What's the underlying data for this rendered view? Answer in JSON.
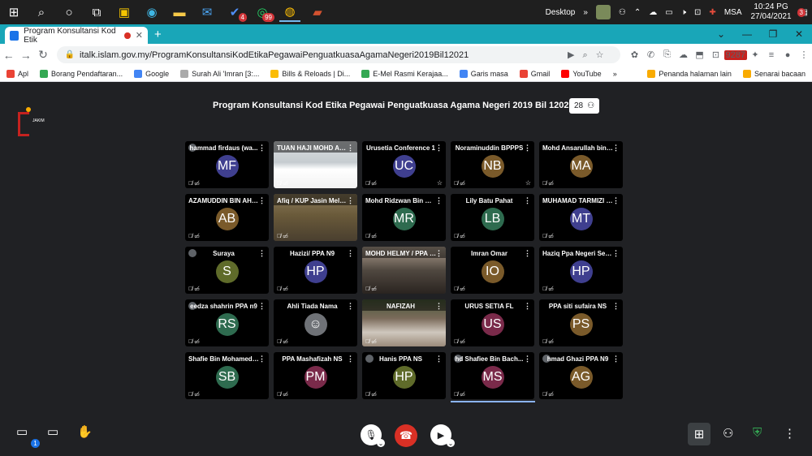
{
  "taskbar": {
    "chat_badge": "4",
    "whatsapp_badge": "99",
    "desktop_label": "Desktop",
    "lang": "MSA",
    "time": "10:24 PG",
    "date": "27/04/2021",
    "notif_badge": "3"
  },
  "browser": {
    "tab_title": "Program Konsultansi Kod Etik",
    "url": "italk.islam.gov.my/ProgramKonsultansiKodEtikaPegawaiPenguatkuasaAgamaNegeri2019Bil12021",
    "ext_badge": "9287",
    "bookmarks": [
      "Apl",
      "Borang Pendaftaran...",
      "Google",
      "Surah Ali 'Imran [3:...",
      "Bills & Reloads | Di...",
      "E-Mel Rasmi Kerajaa...",
      "Garis masa",
      "Gmail",
      "YouTube"
    ],
    "bookmarks_right": [
      "Penanda halaman lain",
      "Senarai bacaan"
    ]
  },
  "meeting": {
    "title": "Program Konsultansi Kod Etika Pegawai Penguatkuasa Agama Negeri 2019 Bil 12021",
    "participant_count": "28",
    "logo_text": "JAKIM"
  },
  "participants": [
    {
      "name": "hammad firdaus (wa...",
      "initials": "MF",
      "color": "#3f3f8f",
      "video": false,
      "star": false,
      "speaking": true
    },
    {
      "name": "TUAN HAJI MOHD AN...",
      "initials": "",
      "color": "",
      "video": true,
      "star": false,
      "speaking": false
    },
    {
      "name": "Urusetia Conference 1",
      "initials": "UC",
      "color": "#3f3f8f",
      "video": false,
      "star": true,
      "speaking": false
    },
    {
      "name": "Noraminuddin BPPPS",
      "initials": "NB",
      "color": "#7a5a2a",
      "video": false,
      "star": true,
      "speaking": false
    },
    {
      "name": "Mohd Ansarullah bin M...",
      "initials": "MA",
      "color": "#7a5a2a",
      "video": false,
      "star": false,
      "speaking": false
    },
    {
      "name": "AZAMUDDIN BIN AHM...",
      "initials": "AB",
      "color": "#7a5a2a",
      "video": false,
      "star": false,
      "speaking": false
    },
    {
      "name": "Afiq / KUP Jasin Melaka",
      "initials": "",
      "color": "",
      "video": true,
      "star": false,
      "speaking": false
    },
    {
      "name": "Mohd Ridzwan Bin Rosl...",
      "initials": "MR",
      "color": "#2e6b4f",
      "video": false,
      "star": false,
      "speaking": false
    },
    {
      "name": "Lily Batu Pahat",
      "initials": "LB",
      "color": "#2e6b4f",
      "video": false,
      "star": false,
      "speaking": false
    },
    {
      "name": "MUHAMAD TARMIZI Z...",
      "initials": "MT",
      "color": "#3f3f8f",
      "video": false,
      "star": false,
      "speaking": false
    },
    {
      "name": "Suraya",
      "initials": "S",
      "color": "#5f6b2a",
      "video": false,
      "star": false,
      "speaking": true
    },
    {
      "name": "Hazizi/ PPA N9",
      "initials": "HP",
      "color": "#3f3f8f",
      "video": false,
      "star": false,
      "speaking": false
    },
    {
      "name": "MOHD HELMY / PPA N...",
      "initials": "",
      "color": "",
      "video": true,
      "star": false,
      "speaking": false
    },
    {
      "name": "Imran Omar",
      "initials": "IO",
      "color": "#7a5a2a",
      "video": false,
      "star": false,
      "speaking": false
    },
    {
      "name": "Haziq Ppa Negeri Sem...",
      "initials": "HP",
      "color": "#3f3f8f",
      "video": false,
      "star": false,
      "speaking": false
    },
    {
      "name": "eedza shahrin PPA n9",
      "initials": "RS",
      "color": "#2e6b4f",
      "video": false,
      "star": false,
      "speaking": true
    },
    {
      "name": "Ahli Tiada Nama",
      "initials": "☺",
      "color": "#6f7277",
      "video": false,
      "star": false,
      "speaking": false
    },
    {
      "name": "NAFIZAH",
      "initials": "",
      "color": "",
      "video": true,
      "star": false,
      "speaking": false
    },
    {
      "name": "URUS SETIA FL",
      "initials": "US",
      "color": "#7a2a4a",
      "video": false,
      "star": false,
      "speaking": false
    },
    {
      "name": "PPA siti sufaira NS",
      "initials": "PS",
      "color": "#7a5a2a",
      "video": false,
      "star": false,
      "speaking": false
    },
    {
      "name": "Shafie Bin Mohamed D...",
      "initials": "SB",
      "color": "#2e6b4f",
      "video": false,
      "star": false,
      "speaking": false
    },
    {
      "name": "PPA Mashafizah NS",
      "initials": "PM",
      "color": "#7a2a4a",
      "video": false,
      "star": false,
      "speaking": false
    },
    {
      "name": "Hanis PPA NS",
      "initials": "HP",
      "color": "#5f6b2a",
      "video": false,
      "star": false,
      "speaking": true
    },
    {
      "name": "hd Shafiee Bin Bach...",
      "initials": "MS",
      "color": "#7a2a4a",
      "video": false,
      "star": false,
      "speaking": true
    },
    {
      "name": "hmad Ghazi PPA N9",
      "initials": "AG",
      "color": "#7a5a2a",
      "video": false,
      "star": false,
      "speaking": true
    }
  ],
  "controls": {
    "chat_badge": "1"
  },
  "colors": {
    "tabstrip": "#19a6b8",
    "meet_bg": "#202124",
    "end_call": "#d93025"
  }
}
